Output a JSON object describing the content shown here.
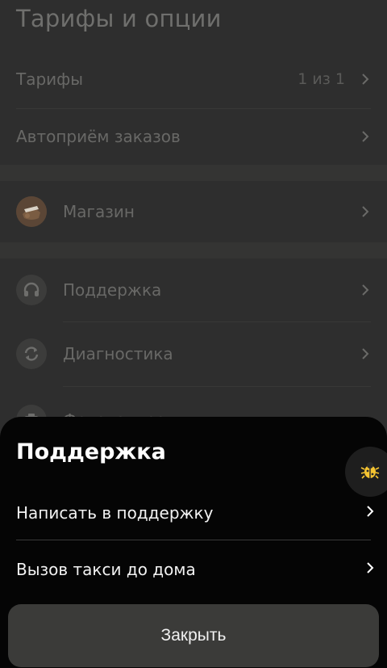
{
  "background_page": {
    "title": "Тарифы и опции",
    "rows": {
      "tariffs": {
        "label": "Тарифы",
        "value": "1 из 1"
      },
      "auto_accept": {
        "label": "Автоприём заказов"
      },
      "shop": {
        "label": "Магазин"
      },
      "support": {
        "label": "Поддержка"
      },
      "diagnostics": {
        "label": "Диагностика"
      },
      "partial": {
        "label": "Фотоконтроль"
      }
    }
  },
  "sheet": {
    "title": "Поддержка",
    "items": [
      {
        "label": "Написать в поддержку"
      },
      {
        "label": "Вызов такси до дома"
      }
    ],
    "close_label": "Закрыть"
  },
  "icons": {
    "chevron": "chevron-right-icon",
    "shop": "shop-avatar-icon",
    "support": "headset-icon",
    "diagnostics": "refresh-icon",
    "bug": "bug-icon"
  },
  "colors": {
    "sheet_background": "#050505",
    "dim_background": "#2e2e2e",
    "close_button": "#3b3b39",
    "bug_accent": "#f5c431"
  }
}
